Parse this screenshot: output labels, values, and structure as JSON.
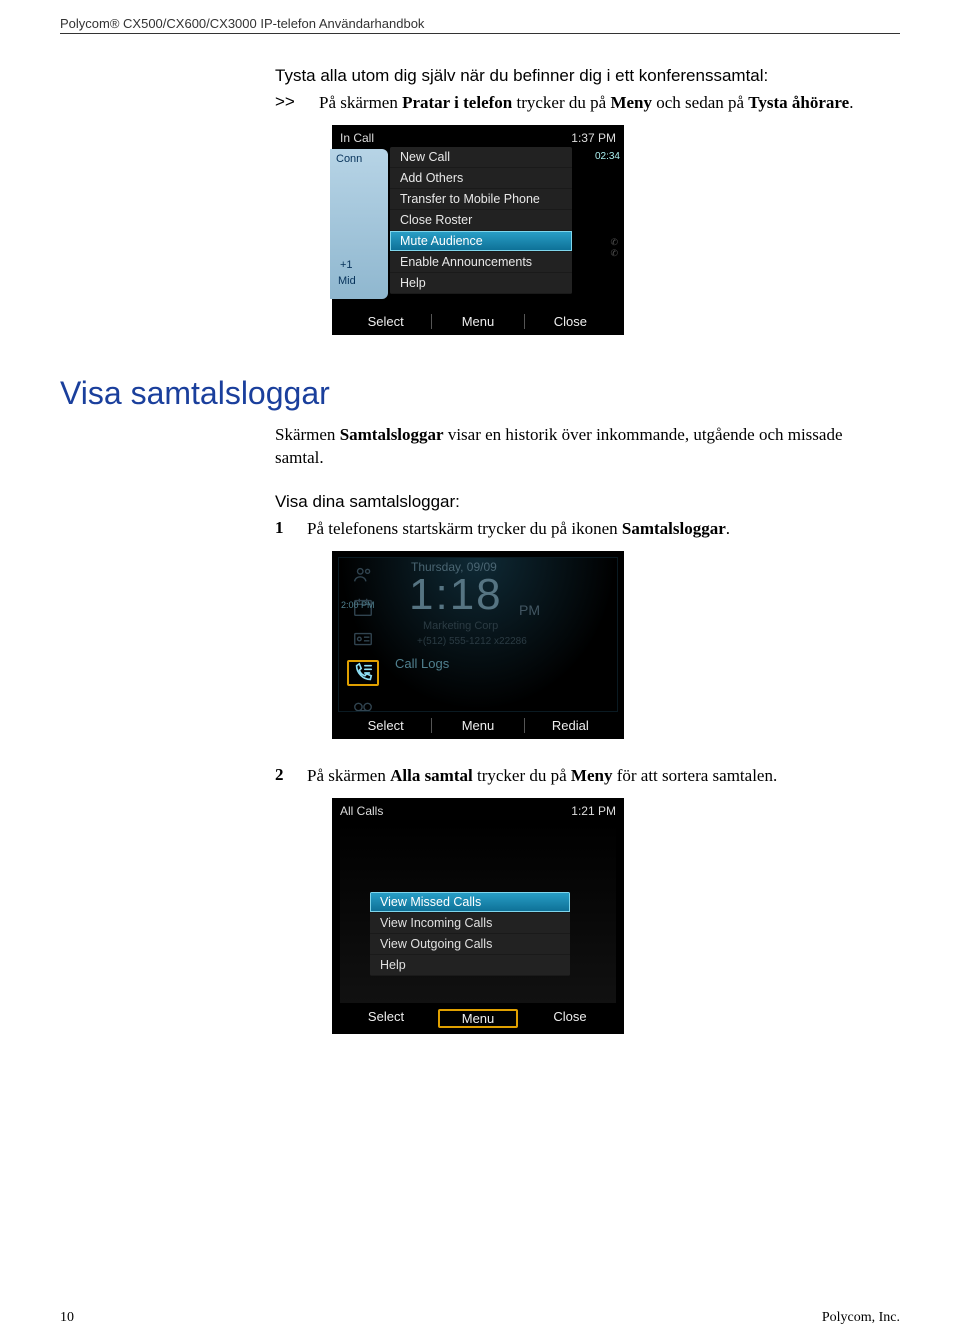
{
  "header": {
    "title": "Polycom® CX500/CX600/CX3000 IP-telefon Användarhandbok"
  },
  "sec1": {
    "heading": "Tysta alla utom dig själv när du befinner dig i ett konferenssamtal:",
    "step_marker": ">>",
    "step_text_parts": {
      "t1": "På skärmen ",
      "b1": "Pratar i telefon",
      "t2": " trycker du på ",
      "b2": "Meny",
      "t3": " och sedan på ",
      "b3": "Tysta åhörare",
      "t4": "."
    }
  },
  "shot1": {
    "title": "In Call",
    "time": "1:37 PM",
    "conn": "Conn",
    "right_time": "02:34",
    "plus": "+1",
    "mid": "Mid",
    "menu": [
      "New Call",
      "Add Others",
      "Transfer to Mobile Phone",
      "Close Roster",
      "Mute Audience",
      "Enable Announcements",
      "Help"
    ],
    "selected_index": 4,
    "softkeys": [
      "Select",
      "Menu",
      "Close"
    ]
  },
  "h2": "Visa samtalsloggar",
  "sec2": {
    "para_parts": {
      "t1": "Skärmen ",
      "b1": "Samtalsloggar",
      "t2": " visar en historik över inkommande, utgående och missade samtal."
    },
    "sub": "Visa dina samtalsloggar:",
    "step1_num": "1",
    "step1": {
      "t1": "På telefonens startskärm trycker du på ikonen ",
      "b1": "Samtalsloggar",
      "t2": "."
    },
    "step2_num": "2",
    "step2": {
      "t1": "På skärmen ",
      "b1": "Alla samtal",
      "t2": " trycker du på ",
      "b2": "Meny",
      "t3": " för att sortera samtalen."
    }
  },
  "shot2": {
    "day": "Thursday, 09/09",
    "bigtime": "1:18",
    "pm": "PM",
    "sub1": "Marketing Corp",
    "sub2": "+(512) 555-1212 x22286",
    "label": "Call Logs",
    "small": "2:00 PM",
    "softkeys": [
      "Select",
      "Menu",
      "Redial"
    ]
  },
  "shot3": {
    "title": "All Calls",
    "time": "1:21 PM",
    "menu": [
      "View Missed Calls",
      "View Incoming Calls",
      "View Outgoing Calls",
      "Help"
    ],
    "selected_index": 0,
    "softkeys": [
      "Select",
      "Menu",
      "Close"
    ]
  },
  "footer": {
    "page": "10",
    "company": "Polycom, Inc."
  }
}
